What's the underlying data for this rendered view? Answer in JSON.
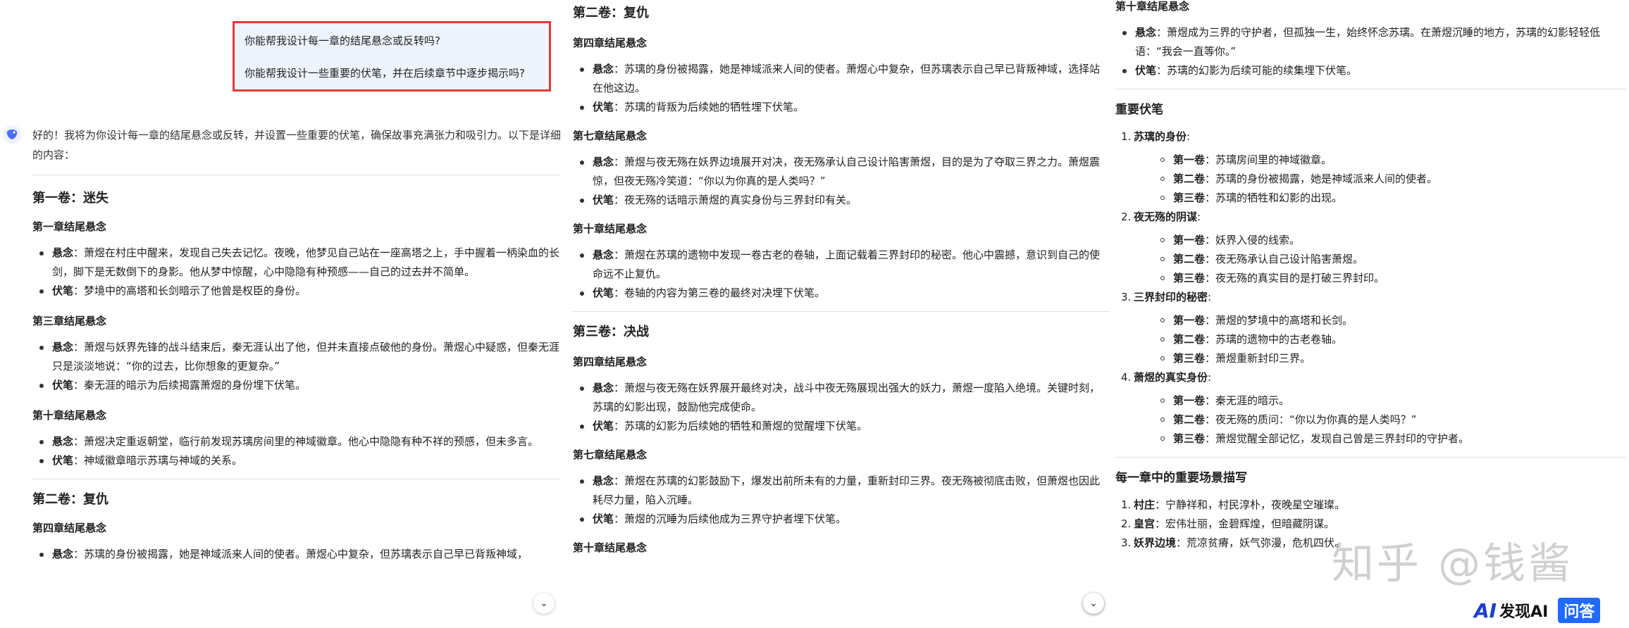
{
  "chat": {
    "user_lines": [
      "你能帮我设计每一章的结尾悬念或反转吗?",
      "你能帮我设计一些重要的伏笔，并在后续章节中逐步揭示吗?"
    ],
    "intro": "好的！我将为你设计每一章的结尾悬念或反转，并设置一些重要的伏笔，确保故事充满张力和吸引力。以下是详细的内容："
  },
  "labels": {
    "suspense": "悬念",
    "foreshadow": "伏笔",
    "colon": "："
  },
  "col1": {
    "vol1": "第一卷：迷失",
    "c1_title": "第一章结尾悬念",
    "c1_s": "萧煜在村庄中醒来，发现自己失去记忆。夜晚，他梦见自己站在一座高塔之上，手中握着一柄染血的长剑，脚下是无数倒下的身影。他从梦中惊醒，心中隐隐有种预感——自己的过去并不简单。",
    "c1_f": "梦境中的高塔和长剑暗示了他曾是权臣的身份。",
    "c3_title": "第三章结尾悬念",
    "c3_s": "萧煜与妖界先锋的战斗结束后，秦无涯认出了他，但并未直接点破他的身份。萧煜心中疑惑，但秦无涯只是淡淡地说：“你的过去，比你想象的更复杂。”",
    "c3_f": "秦无涯的暗示为后续揭露萧煜的身份埋下伏笔。",
    "c10_title": "第十章结尾悬念",
    "c10_s": "萧煜决定重返朝堂，临行前发现苏璃房间里的神域徽章。他心中隐隐有种不祥的预感，但未多言。",
    "c10_f": "神域徽章暗示苏璃与神域的关系。",
    "vol2": "第二卷：复仇",
    "v2c4_title": "第四章结尾悬念",
    "v2c4_s": "苏璃的身份被揭露，她是神域派来人间的使者。萧煜心中复杂，但苏璃表示自己早已背叛神域，"
  },
  "col2": {
    "vol2": "第二卷：复仇",
    "c4_title": "第四章结尾悬念",
    "c4_s": "苏璃的身份被揭露，她是神域派来人间的使者。萧煜心中复杂，但苏璃表示自己早已背叛神域，选择站在他这边。",
    "c4_f": "苏璃的背叛为后续她的牺牲埋下伏笔。",
    "c7_title": "第七章结尾悬念",
    "c7_s": "萧煜与夜无殇在妖界边境展开对决，夜无殇承认自己设计陷害萧煜，目的是为了夺取三界之力。萧煜震惊，但夜无殇冷笑道：“你以为你真的是人类吗？”",
    "c7_f": "夜无殇的话暗示萧煜的真实身份与三界封印有关。",
    "c10_title": "第十章结尾悬念",
    "c10_s": "萧煜在苏璃的遗物中发现一卷古老的卷轴，上面记载着三界封印的秘密。他心中震撼，意识到自己的使命远不止复仇。",
    "c10_f": "卷轴的内容为第三卷的最终对决埋下伏笔。",
    "vol3": "第三卷：决战",
    "v3c4_title": "第四章结尾悬念",
    "v3c4_s": "萧煜与夜无殇在妖界展开最终对决，战斗中夜无殇展现出强大的妖力，萧煜一度陷入绝境。关键时刻，苏璃的幻影出现，鼓励他完成使命。",
    "v3c4_f": "苏璃的幻影为后续她的牺牲和萧煜的觉醒埋下伏笔。",
    "v3c7_title": "第七章结尾悬念",
    "v3c7_s": "萧煜在苏璃的幻影鼓励下，爆发出前所未有的力量，重新封印三界。夜无殇被彻底击败，但萧煜也因此耗尽力量，陷入沉睡。",
    "v3c7_f": "萧煜的沉睡为后续他成为三界守护者埋下伏笔。",
    "v3c10_title": "第十章结尾悬念"
  },
  "col3": {
    "c10_title": "第十章结尾悬念",
    "c10_s": "萧煜成为三界的守护者，但孤独一生，始终怀念苏璃。在萧煜沉睡的地方，苏璃的幻影轻轻低语：“我会一直等你。”",
    "c10_f": "苏璃的幻影为后续可能的续集埋下伏笔。",
    "fs_title": "重要伏笔",
    "groups": [
      {
        "num": "1.",
        "title": "苏璃的身份",
        "items": [
          {
            "k": "第一卷",
            "v": "苏璃房间里的神域徽章。"
          },
          {
            "k": "第二卷",
            "v": "苏璃的身份被揭露，她是神域派来人间的使者。"
          },
          {
            "k": "第三卷",
            "v": "苏璃的牺牲和幻影的出现。"
          }
        ]
      },
      {
        "num": "2.",
        "title": "夜无殇的阴谋",
        "items": [
          {
            "k": "第一卷",
            "v": "妖界入侵的线索。"
          },
          {
            "k": "第二卷",
            "v": "夜无殇承认自己设计陷害萧煜。"
          },
          {
            "k": "第三卷",
            "v": "夜无殇的真实目的是打破三界封印。"
          }
        ]
      },
      {
        "num": "3.",
        "title": "三界封印的秘密",
        "items": [
          {
            "k": "第一卷",
            "v": "萧煜的梦境中的高塔和长剑。"
          },
          {
            "k": "第二卷",
            "v": "苏璃的遗物中的古老卷轴。"
          },
          {
            "k": "第三卷",
            "v": "萧煜重新封印三界。"
          }
        ]
      },
      {
        "num": "4.",
        "title": "萧煜的真实身份",
        "items": [
          {
            "k": "第一卷",
            "v": "秦无涯的暗示。"
          },
          {
            "k": "第二卷",
            "v": "夜无殇的质问：“你以为你真的是人类吗？”"
          },
          {
            "k": "第三卷",
            "v": "萧煜觉醒全部记忆，发现自己曾是三界封印的守护者。"
          }
        ]
      }
    ],
    "scene_title": "每一章中的重要场景描写",
    "scenes": [
      {
        "num": "1.",
        "k": "村庄",
        "v": "宁静祥和，村民淳朴，夜晚星空璀璨。"
      },
      {
        "num": "2.",
        "k": "皇宫",
        "v": "宏伟壮丽，金碧辉煌，但暗藏阴谋。"
      },
      {
        "num": "3.",
        "k": "妖界边境",
        "v": "荒凉贫瘠，妖气弥漫，危机四伏。"
      }
    ]
  },
  "watermark": "知乎 @钱酱",
  "brand": {
    "logo": "AI",
    "name": "发现AI",
    "ask": "问答"
  },
  "scroll_glyph": "⌄"
}
